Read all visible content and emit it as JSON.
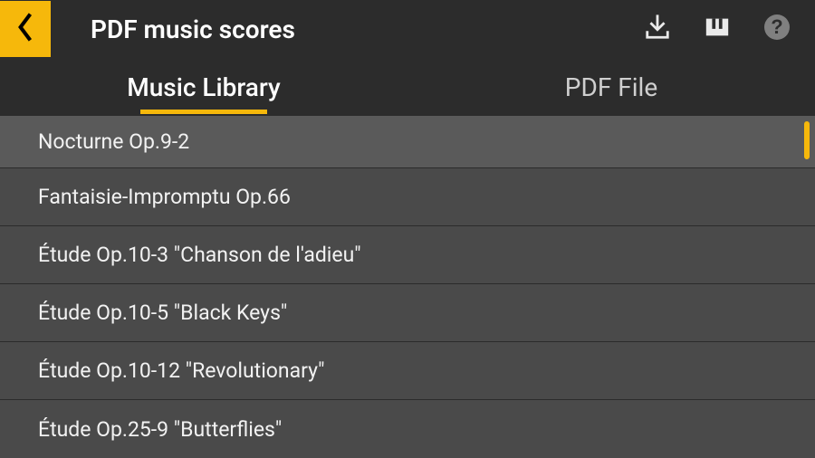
{
  "header": {
    "title": "PDF music scores"
  },
  "tabs": [
    {
      "label": "Music Library",
      "active": true
    },
    {
      "label": "PDF File",
      "active": false
    }
  ],
  "list": {
    "items": [
      {
        "title": "Nocturne Op.9-2"
      },
      {
        "title": "Fantaisie-Impromptu Op.66"
      },
      {
        "title": "Étude Op.10-3 \"Chanson de l'adieu\""
      },
      {
        "title": "Étude Op.10-5 \"Black Keys\""
      },
      {
        "title": "Étude Op.10-12 \"Revolutionary\""
      },
      {
        "title": "Étude Op.25-9 \"Butterflies\""
      }
    ]
  },
  "colors": {
    "accent": "#f6b80b",
    "bg": "#2c2c2c",
    "rowBg": "#4a4a4a",
    "firstRowBg": "#5a5a5a"
  }
}
